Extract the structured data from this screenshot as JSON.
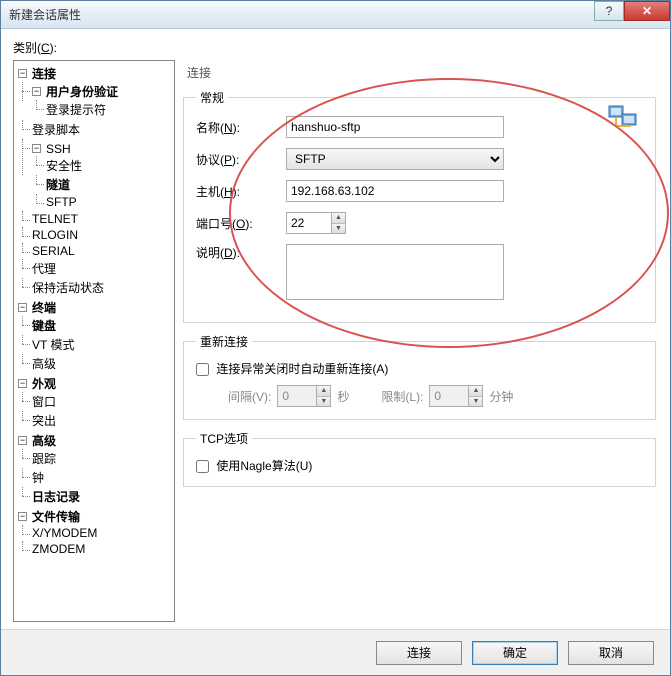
{
  "window": {
    "title": "新建会话属性",
    "help_icon": "?",
    "close_icon": "✕"
  },
  "categories_label": {
    "text": "类别(",
    "hotkey": "C",
    "suffix": "):"
  },
  "tree": {
    "connection": "连接",
    "user_auth": "用户身份验证",
    "login_prompt": "登录提示符",
    "login_script": "登录脚本",
    "ssh": "SSH",
    "security": "安全性",
    "tunnel": "隧道",
    "sftp": "SFTP",
    "telnet": "TELNET",
    "rlogin": "RLOGIN",
    "serial": "SERIAL",
    "proxy": "代理",
    "keepalive": "保持活动状态",
    "terminal": "终端",
    "keyboard": "键盘",
    "vtmode": "VT 模式",
    "advanced": "高级",
    "appearance": "外观",
    "window": "窗口",
    "highlight": "突出",
    "advanced2": "高级",
    "trace": "跟踪",
    "clock": "钟",
    "logging": "日志记录",
    "filetransfer": "文件传输",
    "xymodem": "X/YMODEM",
    "zmodem": "ZMODEM"
  },
  "content": {
    "header": "连接",
    "general_group": "常规",
    "name_label": {
      "text": "名称(",
      "hotkey": "N",
      "suffix": "):"
    },
    "name_value": "hanshuo-sftp",
    "protocol_label": {
      "text": "协议(",
      "hotkey": "P",
      "suffix": "):"
    },
    "protocol_value": "SFTP",
    "host_label": {
      "text": "主机(",
      "hotkey": "H",
      "suffix": "):"
    },
    "host_value": "192.168.63.102",
    "port_label": {
      "text": "端口号(",
      "hotkey": "O",
      "suffix": "):"
    },
    "port_value": "22",
    "desc_label": {
      "text": "说明(",
      "hotkey": "D",
      "suffix": "):"
    },
    "desc_value": "",
    "reconnect_group": "重新连接",
    "reconnect_chk": {
      "text": "连接异常关闭时自动重新连接(",
      "hotkey": "A",
      "suffix": ")"
    },
    "interval_label": {
      "text": "间隔(",
      "hotkey": "V",
      "suffix": "):"
    },
    "interval_value": "0",
    "seconds": "秒",
    "limit_label": {
      "text": "限制(",
      "hotkey": "L",
      "suffix": "):"
    },
    "limit_value": "0",
    "minutes": "分钟",
    "tcp_group": "TCP选项",
    "nagle_chk": {
      "text": "使用Nagle算法(",
      "hotkey": "U",
      "suffix": ")"
    }
  },
  "buttons": {
    "connect": "连接",
    "ok": "确定",
    "cancel": "取消"
  }
}
